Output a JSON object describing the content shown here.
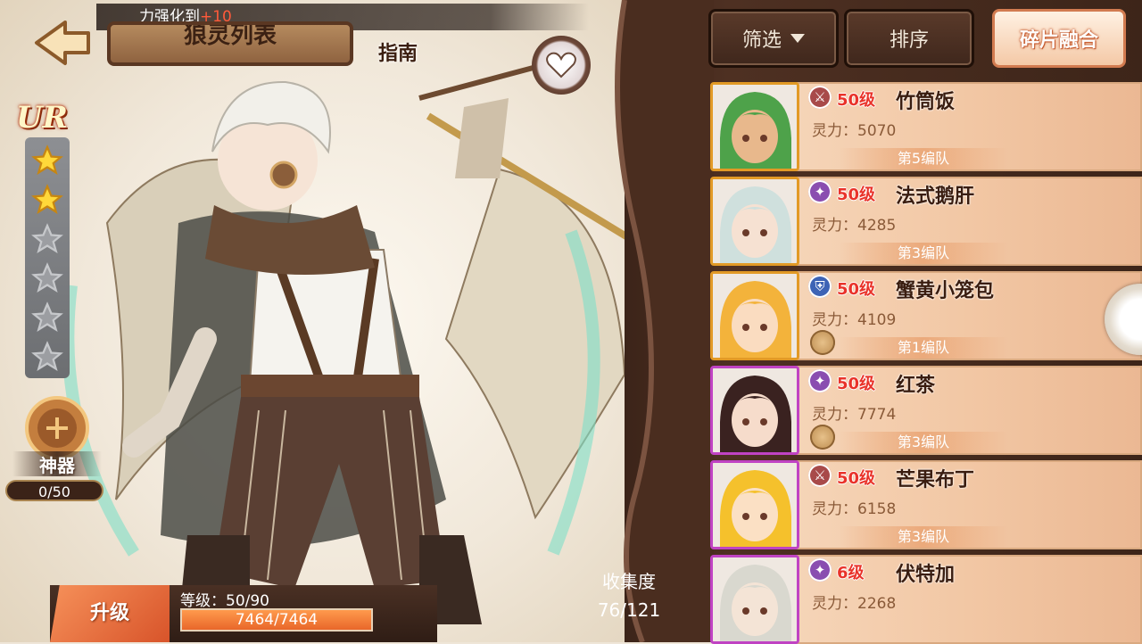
{
  "toast": {
    "prefix": "力强化到",
    "value": "+10"
  },
  "header": {
    "title": "狼灵列表",
    "guide_label": "指南"
  },
  "rarity": "UR",
  "stars": {
    "filled": 2,
    "total": 6
  },
  "artifact": {
    "label": "神器",
    "count": "0/50"
  },
  "upgrade": {
    "button_label": "升级",
    "level_text": "等级：50/90",
    "exp_text": "7464/7464",
    "exp_fraction": 1.0
  },
  "collection": {
    "label": "收集度",
    "value": "76/121"
  },
  "toolbar": {
    "filter_label": "筛选",
    "sort_label": "排序",
    "fragment_label": "碎片融合"
  },
  "characters": [
    {
      "level": "50级",
      "name": "竹筒饭",
      "power": "灵力：5070",
      "team": "第5编队",
      "frame": "gold",
      "class_color": "#a84a4a",
      "class_icon": "sword-icon",
      "token": false,
      "hair": "#4ea24a",
      "skin": "#e8b88c"
    },
    {
      "level": "50级",
      "name": "法式鹅肝",
      "power": "灵力：4285",
      "team": "第3编队",
      "frame": "gold",
      "class_color": "#8a4db0",
      "class_icon": "magic-icon",
      "token": false,
      "hair": "#cfe0dd",
      "skin": "#f6e1d2"
    },
    {
      "level": "50级",
      "name": "蟹黄小笼包",
      "power": "灵力：4109",
      "team": "第1编队",
      "frame": "gold",
      "class_color": "#3d63b5",
      "class_icon": "shield-icon",
      "token": true,
      "hair": "#f3b33b",
      "skin": "#fadcc0"
    },
    {
      "level": "50级",
      "name": "红茶",
      "power": "灵力：7774",
      "team": "第3编队",
      "frame": "purple",
      "class_color": "#8a4db0",
      "class_icon": "magic-icon",
      "token": true,
      "hair": "#3a2220",
      "skin": "#f6dccb"
    },
    {
      "level": "50级",
      "name": "芒果布丁",
      "power": "灵力：6158",
      "team": "第3编队",
      "frame": "purple",
      "class_color": "#a84a4a",
      "class_icon": "sword-icon",
      "token": false,
      "hair": "#f5c12c",
      "skin": "#fbe0c4"
    },
    {
      "level": "6级",
      "name": "伏特加",
      "power": "灵力：2268",
      "team": "",
      "frame": "purple",
      "class_color": "#8a4db0",
      "class_icon": "magic-icon",
      "token": false,
      "hair": "#d9d8cf",
      "skin": "#f4e4d6"
    }
  ]
}
